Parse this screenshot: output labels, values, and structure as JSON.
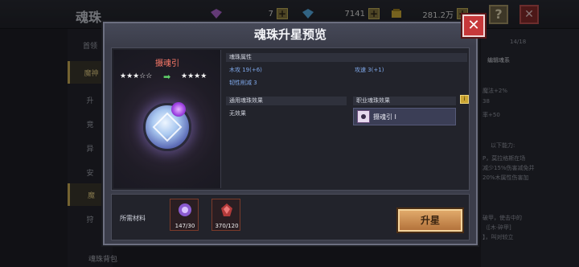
{
  "background": {
    "title": "魂珠",
    "resources": [
      {
        "icon": "purple-gem-icon",
        "value": "7"
      },
      {
        "icon": "blue-diamond-icon",
        "value": "7141"
      },
      {
        "icon": "gold-coin-icon",
        "value": "281.2万"
      }
    ],
    "help": "?",
    "close": "✕",
    "left_tabs": [
      "首领",
      "魔神",
      "升",
      "竞",
      "异",
      "安",
      "魔",
      "狩"
    ],
    "right_texts": {
      "count": "14/18",
      "edit": "编辑魂系",
      "stat1": "魔法+2%",
      "stat2": "38",
      "stat3": "率+50",
      "hint": "以下能力:",
      "desc1": "P，莫拉格斯在场",
      "desc2": "减少15%伤害减免并",
      "desc3": "20%木属性伤害加",
      "desc4": "破甲，使击中的",
      "desc5": "（[木·碎甲]",
      "desc6": "】，叫对较立"
    },
    "bottom_label": "魂珠背包"
  },
  "modal": {
    "title": "魂珠升星预览",
    "close": "✕",
    "soul_name": "摄魂引",
    "stars_before": "★★★☆☆",
    "stars_after": "★★★★",
    "attributes_header": "魂珠属性",
    "attributes": {
      "wood_attack": "木攻 19(+6)",
      "attack": "攻速 3(+1)",
      "toughness": "韧性削减 3"
    },
    "generic_effect_header": "通用魂珠效果",
    "generic_effect_value": "无效果",
    "job_effect_header": "职业魂珠效果",
    "job_effect_value": "摄魂引 I",
    "materials_label": "所需材料",
    "materials": [
      {
        "icon": "soul-crystal-icon",
        "count": "147/30"
      },
      {
        "icon": "red-ore-icon",
        "count": "370/120"
      }
    ],
    "upgrade_button": "升星"
  },
  "colors": {
    "accent": "#c6383a",
    "blue_attr": "#7fa8ea",
    "name_red": "#ff7b6a",
    "button_orange": "#d79c5f"
  }
}
